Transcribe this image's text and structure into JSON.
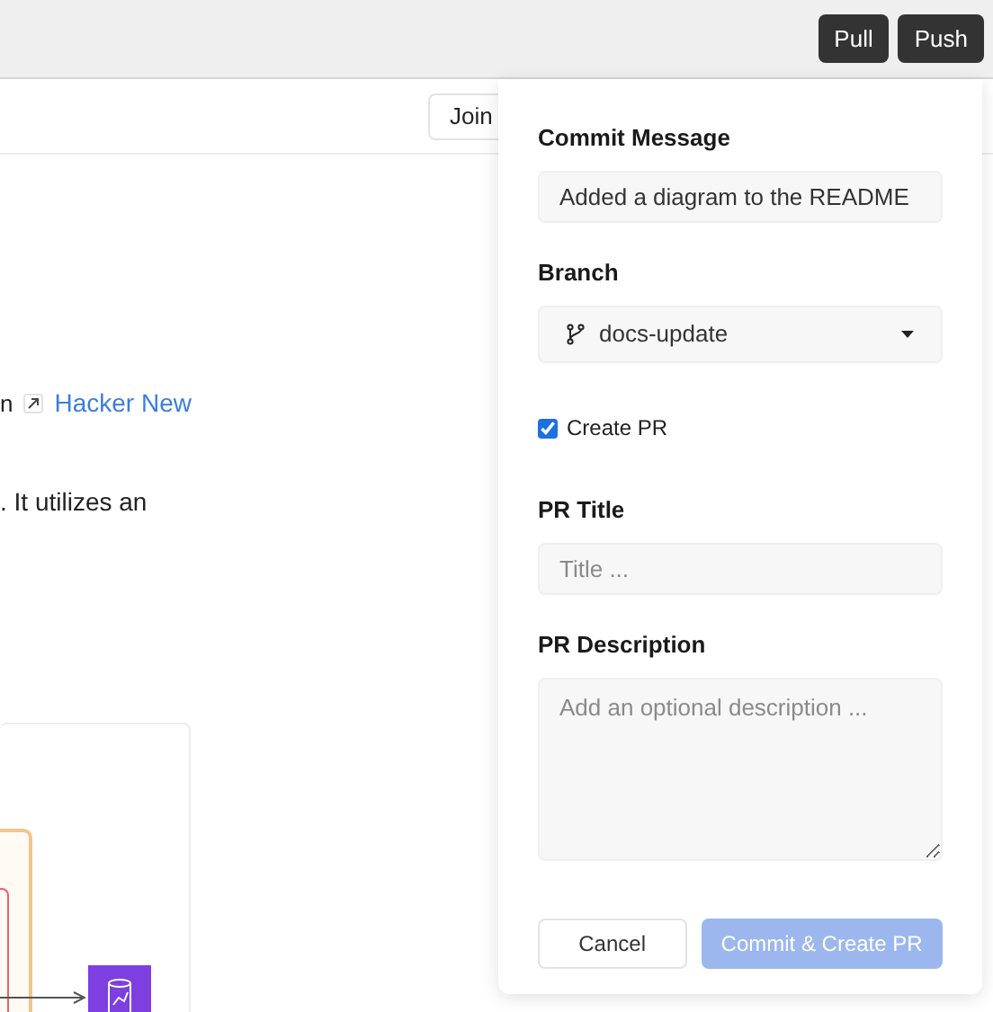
{
  "toolbar": {
    "buttons": [
      "Pull",
      "Push"
    ]
  },
  "page": {
    "join_button": "Join",
    "link_line": {
      "text_before": "n",
      "link": "Hacker New"
    },
    "paragraph": ". It utilizes an"
  },
  "commit_panel": {
    "commit_message": {
      "label": "Commit Message",
      "value": "Added a diagram to the README"
    },
    "branch": {
      "label": "Branch",
      "value": "docs-update"
    },
    "create_pr": {
      "label": "Create PR",
      "checked": true
    },
    "pr_title": {
      "label": "PR Title",
      "placeholder": "Title ..."
    },
    "pr_description": {
      "label": "PR Description",
      "placeholder": "Add an optional description ..."
    },
    "cancel_button": "Cancel",
    "submit_button": {
      "label": "Commit & Create PR",
      "disabled": true
    }
  }
}
